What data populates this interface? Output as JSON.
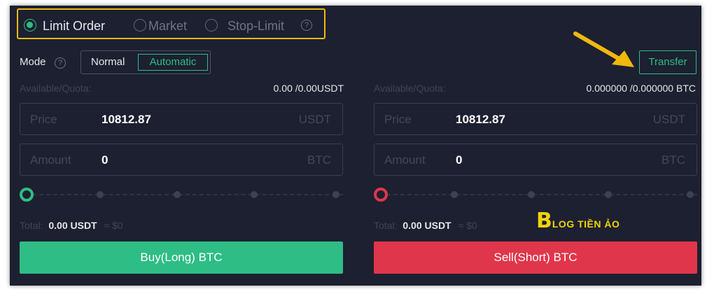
{
  "order_types": [
    {
      "label": "Limit Order",
      "selected": true
    },
    {
      "label": "Market",
      "selected": false
    },
    {
      "label": "Stop-Limit",
      "selected": false
    }
  ],
  "help_glyph": "?",
  "mode": {
    "label": "Mode",
    "options": [
      "Normal",
      "Automatic"
    ],
    "active": "Automatic"
  },
  "transfer_label": "Transfer",
  "buy": {
    "available_label": "Available/Quota:",
    "available_value": "0.00 /0.00USDT",
    "price": {
      "label": "Price",
      "value": "10812.87",
      "unit": "USDT"
    },
    "amount": {
      "label": "Amount",
      "value": "0",
      "unit": "BTC"
    },
    "slider_percent": 0,
    "total_label": "Total:",
    "total_value": "0.00 USDT",
    "total_approx": "≈ $0",
    "button_label": "Buy(Long) BTC"
  },
  "sell": {
    "available_label": "Available/Quota:",
    "available_value": "0.000000 /0.000000 BTC",
    "price": {
      "label": "Price",
      "value": "10812.87",
      "unit": "USDT"
    },
    "amount": {
      "label": "Amount",
      "value": "0",
      "unit": "BTC"
    },
    "slider_percent": 0,
    "total_label": "Total:",
    "total_value": "0.00 USDT",
    "total_approx": "≈ $0",
    "button_label": "Sell(Short) BTC"
  },
  "watermark": {
    "letter": "B",
    "text": "LOG TIỀN ẢO"
  },
  "colors": {
    "panel_bg": "#1c2030",
    "accent_green": "#2ebd85",
    "accent_red": "#e0364b",
    "highlight_yellow": "#f0b90b"
  }
}
